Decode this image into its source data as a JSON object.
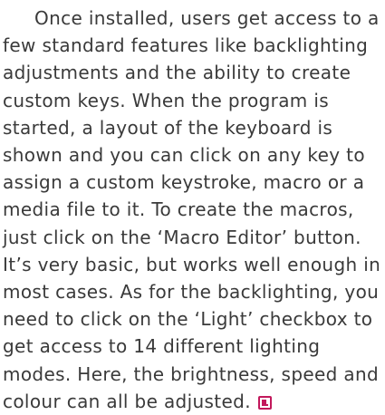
{
  "article": {
    "paragraph": "Once installed, users get access to a few standard features like backlighting adjustments and the ability to create custom keys. When the program is started, a layout of the keyboard is shown and you can click on any key to assign a custom keystroke, macro or a media file to it. To create the macros, just click on the ‘Macro Editor’ button. It’s very basic, but works well enough in most cases. As for the backlighting, you need to click on the ‘Light’ checkbox to get access to 14 different lighting modes. Here, the brightness, speed and colour can all be adjusted."
  },
  "colors": {
    "text": "#3a3a3a",
    "accent": "#c2185b"
  },
  "icons": {
    "end_marker": "article-end-icon"
  }
}
